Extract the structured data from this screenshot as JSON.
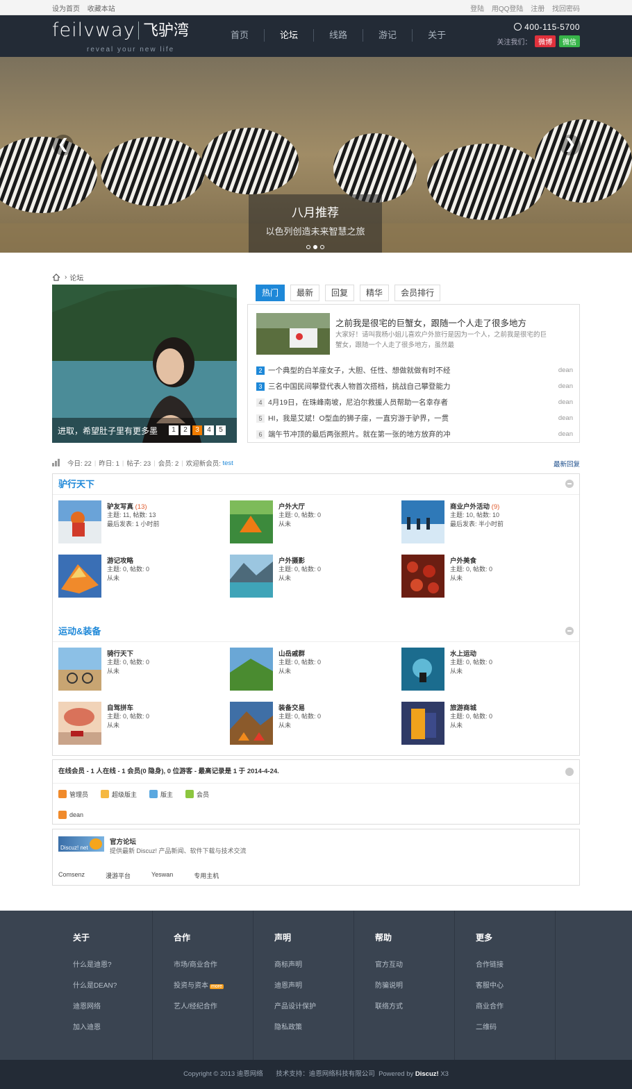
{
  "topbar": {
    "set_home": "设为首页",
    "bookmark": "收藏本站",
    "links": [
      "登陆",
      "用QQ登陆",
      "注册",
      "找回密码"
    ]
  },
  "header": {
    "brand": "feilvway",
    "brand_cn": "飞驴湾",
    "slogan": "reveal your new life",
    "nav": [
      "首页",
      "论坛",
      "线路",
      "游记",
      "关于"
    ],
    "active_nav": "论坛",
    "phone": "400-115-5700",
    "follow_label": "关注我们：",
    "weibo": "微博",
    "weixin": "微信"
  },
  "banner": {
    "title": "八月推荐",
    "subtitle": "以色列创造未来智慧之旅",
    "prev": "❮",
    "next": "❯"
  },
  "breadcrumb": {
    "current": "论坛"
  },
  "photo": {
    "caption": "进取，希望肚子里有更多墨",
    "pages": [
      "1",
      "2",
      "3",
      "4",
      "5"
    ],
    "active_page": "3"
  },
  "tabs": [
    "热门",
    "最新",
    "回复",
    "精华",
    "会员排行"
  ],
  "hot": {
    "feature_title": "之前我是很宅的巨蟹女，跟随一个人走了很多地方",
    "feature_desc": "大家好！请叫我杨小姐儿喜欢户外旅行是因为一个人，之前我是很宅的巨蟹女，跟随一个人走了很多地方，虽然最",
    "items": [
      {
        "n": "2",
        "title": "一个典型的白羊座女子，大胆、任性、想做就做有时不经",
        "author": "dean"
      },
      {
        "n": "3",
        "title": "三名中国民间攀登代表人物首次搭档，挑战自己攀登能力",
        "author": "dean"
      },
      {
        "n": "4",
        "title": "4月19日，在珠峰南坡，尼泊尔救援人员帮助一名幸存者",
        "author": "dean"
      },
      {
        "n": "5",
        "title": "HI，我是艾斌！O型血的狮子座，一直穷游于驴界，一贯",
        "author": "dean"
      },
      {
        "n": "6",
        "title": "端午节冲顶的最后两张照片。就在第一张的地方放弃的冲",
        "author": "dean"
      }
    ]
  },
  "stats": {
    "today": "今日: 22",
    "yesterday": "昨日: 1",
    "posts": "帖子: 23",
    "members": "会员: 2",
    "welcome": "欢迎新会员:",
    "new_user": "test",
    "latest": "最新回复"
  },
  "sections": [
    {
      "title": "驴行天下",
      "forums": [
        {
          "name": "驴友写真",
          "count": "(13)",
          "l1": "主题: 11, 帖数: 13",
          "l2": "最后发表: 1 小时前"
        },
        {
          "name": "户外大厅",
          "count": "",
          "l1": "主题: 0, 帖数: 0",
          "l2": "从未"
        },
        {
          "name": "商业户外活动",
          "count": "(9)",
          "l1": "主题: 10, 帖数: 10",
          "l2": "最后发表: 半小时前"
        },
        {
          "name": "游记攻略",
          "count": "",
          "l1": "主题: 0, 帖数: 0",
          "l2": "从未"
        },
        {
          "name": "户外摄影",
          "count": "",
          "l1": "主题: 0, 帖数: 0",
          "l2": "从未"
        },
        {
          "name": "户外美食",
          "count": "",
          "l1": "主题: 0, 帖数: 0",
          "l2": "从未"
        }
      ]
    },
    {
      "title": "运动&装备",
      "forums": [
        {
          "name": "骑行天下",
          "count": "",
          "l1": "主题: 0, 帖数: 0",
          "l2": "从未"
        },
        {
          "name": "山岳戚群",
          "count": "",
          "l1": "主题: 0, 帖数: 0",
          "l2": "从未"
        },
        {
          "name": "水上运动",
          "count": "",
          "l1": "主题: 0, 帖数: 0",
          "l2": "从未"
        },
        {
          "name": "自驾拼车",
          "count": "",
          "l1": "主题: 0, 帖数: 0",
          "l2": "从未"
        },
        {
          "name": "装备交易",
          "count": "",
          "l1": "主题: 0, 帖数: 0",
          "l2": "从未"
        },
        {
          "name": "旅游商城",
          "count": "",
          "l1": "主题: 0, 帖数: 0",
          "l2": "从未"
        }
      ]
    }
  ],
  "online": {
    "summary": "在线会员 - 1 人在线 - 1 会员(0 隐身), 0 位游客 - 最高记录是 1 于 2014-4-24.",
    "legend": [
      "管理员",
      "超级版主",
      "版主",
      "会员"
    ],
    "user": "dean"
  },
  "links": {
    "logo_text": "Discuz! net",
    "title": "官方论坛",
    "desc": "提供最新 Discuz! 产品新闻、软件下载与技术交流",
    "items": [
      "Comsenz",
      "漫游平台",
      "Yeswan",
      "专用主机"
    ]
  },
  "footer": [
    {
      "title": "关于",
      "items": [
        "什么是迪恩?",
        "什么是DEAN?",
        "迪恩网络",
        "加入迪恩"
      ]
    },
    {
      "title": "合作",
      "items": [
        "市场/商业合作",
        "投资与资本",
        "艺人/经纪合作"
      ]
    },
    {
      "title": "声明",
      "items": [
        "商标声明",
        "迪恩声明",
        "产品设计保护",
        "隐私政策"
      ]
    },
    {
      "title": "帮助",
      "items": [
        "官方互动",
        "防骗说明",
        "联络方式"
      ]
    },
    {
      "title": "更多",
      "items": [
        "合作链接",
        "客服中心",
        "商业合作",
        "二维码"
      ]
    }
  ],
  "footer_badge": "more",
  "copyright": {
    "text": "Copyright © 2013 迪恩网络",
    "support": "技术支持：迪恩网络科技有限公司",
    "powered": "Powered by",
    "discuz": "Discuz!",
    "ver": "X3"
  }
}
